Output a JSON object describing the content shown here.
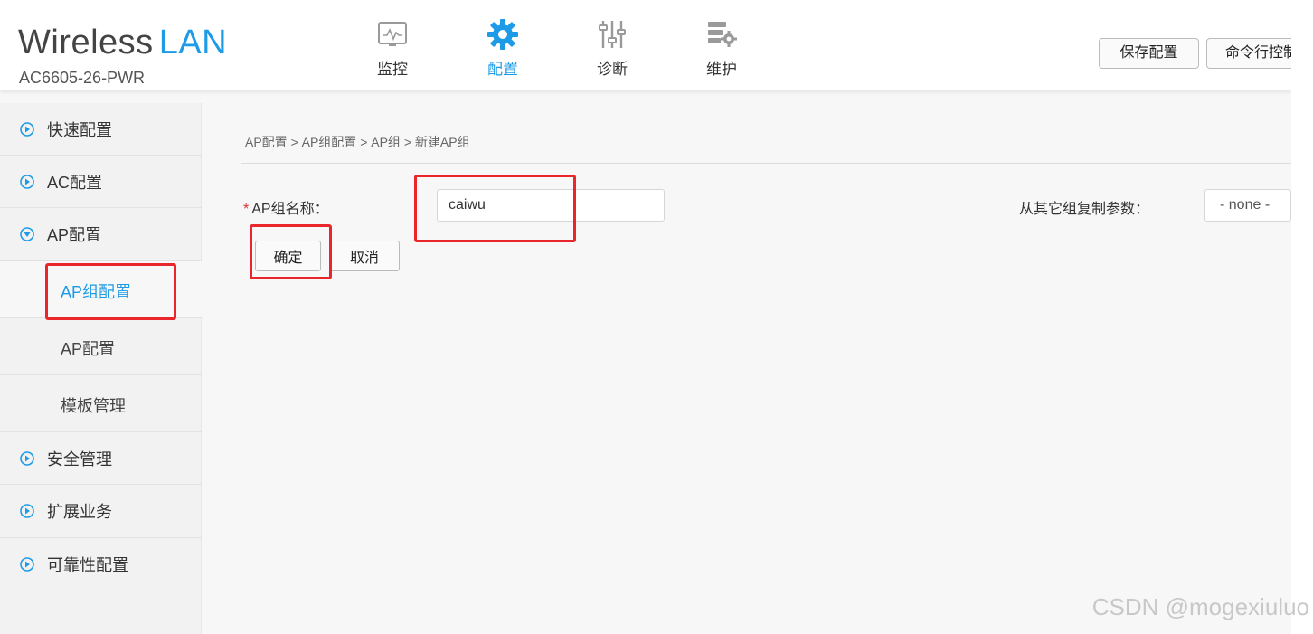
{
  "header": {
    "brand_part1": "Wireless",
    "brand_part2": "LAN",
    "model": "AC6605-26-PWR",
    "nav": [
      {
        "label": "监控",
        "icon": "monitor-icon"
      },
      {
        "label": "配置",
        "icon": "gear-icon",
        "active": true
      },
      {
        "label": "诊断",
        "icon": "sliders-icon"
      },
      {
        "label": "维护",
        "icon": "server-gear-icon"
      }
    ],
    "save_config": "保存配置",
    "command_console": "命令行控制"
  },
  "sidebar": {
    "items": [
      {
        "label": "快速配置",
        "icon": "circle-arrow-right-icon"
      },
      {
        "label": "AC配置",
        "icon": "circle-arrow-right-icon"
      },
      {
        "label": "AP配置",
        "icon": "circle-arrow-down-icon",
        "expanded": true
      },
      {
        "label": "安全管理",
        "icon": "circle-arrow-right-icon"
      },
      {
        "label": "扩展业务",
        "icon": "circle-arrow-right-icon"
      },
      {
        "label": "可靠性配置",
        "icon": "circle-arrow-right-icon"
      }
    ],
    "subitems": [
      {
        "label": "AP组配置",
        "active": true
      },
      {
        "label": "AP配置"
      },
      {
        "label": "模板管理"
      }
    ]
  },
  "main": {
    "breadcrumb": "AP配置 > AP组配置 > AP组 > 新建AP组",
    "group_name_label": "AP组名称：",
    "group_name_required": "*",
    "group_name_value": "caiwu",
    "copy_label": "从其它组复制参数：",
    "copy_value": "- none -",
    "confirm": "确定",
    "cancel": "取消"
  },
  "watermark": "CSDN @mogexiuluo",
  "colors": {
    "accent": "#1e9be6",
    "annotation": "#e8262b",
    "required": "#e0302a"
  }
}
